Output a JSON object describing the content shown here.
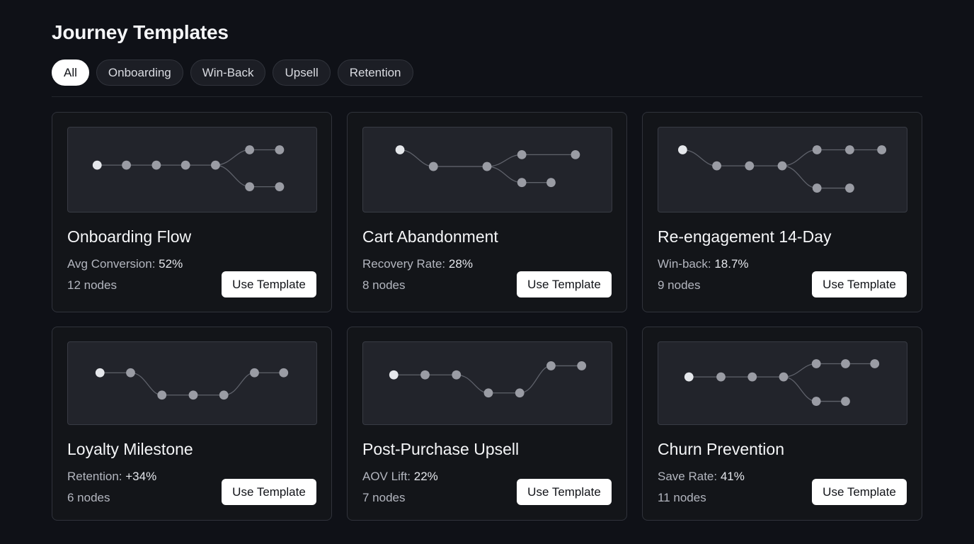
{
  "page_title": "Journey Templates",
  "filters": [
    {
      "label": "All",
      "active": true
    },
    {
      "label": "Onboarding",
      "active": false
    },
    {
      "label": "Win-Back",
      "active": false
    },
    {
      "label": "Upsell",
      "active": false
    },
    {
      "label": "Retention",
      "active": false
    }
  ],
  "colors": {
    "background": "#0f1117",
    "card_border": "#30333b",
    "preview_bg": "#22242b",
    "node_start": "#e5e7eb",
    "node": "#9a9ca4",
    "edge": "#5f626b",
    "button_bg": "#ffffff",
    "button_text": "#111318"
  },
  "templates": [
    {
      "title": "Onboarding Flow",
      "metric_label": "Avg Conversion:",
      "metric_value": "52%",
      "nodes_label": "12 nodes",
      "button_label": "Use Template"
    },
    {
      "title": "Cart Abandonment",
      "metric_label": "Recovery Rate:",
      "metric_value": "28%",
      "nodes_label": "8 nodes",
      "button_label": "Use Template"
    },
    {
      "title": "Re-engagement 14-Day",
      "metric_label": "Win-back:",
      "metric_value": "18.7%",
      "nodes_label": "9 nodes",
      "button_label": "Use Template"
    },
    {
      "title": "Loyalty Milestone",
      "metric_label": "Retention:",
      "metric_value": "+34%",
      "nodes_label": "6 nodes",
      "button_label": "Use Template"
    },
    {
      "title": "Post-Purchase Upsell",
      "metric_label": "AOV Lift:",
      "metric_value": "22%",
      "nodes_label": "7 nodes",
      "button_label": "Use Template"
    },
    {
      "title": "Churn Prevention",
      "metric_label": "Save Rate:",
      "metric_value": "41%",
      "nodes_label": "11 nodes",
      "button_label": "Use Template"
    }
  ]
}
